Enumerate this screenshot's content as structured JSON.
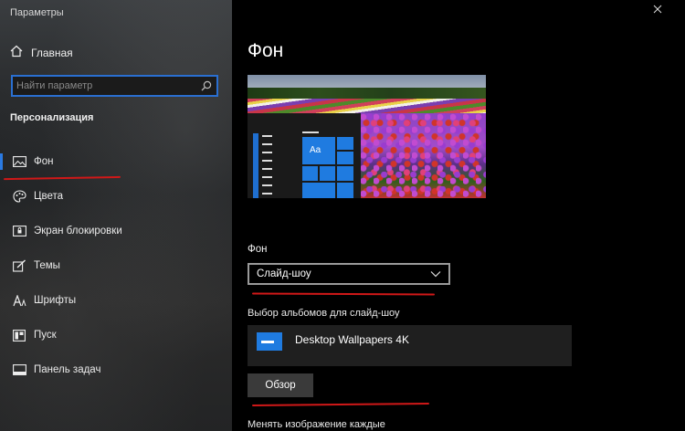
{
  "window": {
    "title": "Параметры",
    "close_icon": "close-icon"
  },
  "sidebar": {
    "home_label": "Главная",
    "search_placeholder": "Найти параметр",
    "section_title": "Персонализация",
    "items": [
      {
        "label": "Фон",
        "icon": "picture-icon",
        "active": true
      },
      {
        "label": "Цвета",
        "icon": "palette-icon",
        "active": false
      },
      {
        "label": "Экран блокировки",
        "icon": "lock-screen-icon",
        "active": false
      },
      {
        "label": "Темы",
        "icon": "brush-icon",
        "active": false
      },
      {
        "label": "Шрифты",
        "icon": "font-icon",
        "active": false
      },
      {
        "label": "Пуск",
        "icon": "start-icon",
        "active": false
      },
      {
        "label": "Панель задач",
        "icon": "taskbar-icon",
        "active": false
      }
    ]
  },
  "main": {
    "page_title": "Фон",
    "preview_tile_text": "Aa",
    "background_label": "Фон",
    "background_value": "Слайд-шоу",
    "albums_label": "Выбор альбомов для слайд-шоу",
    "album_name": "Desktop Wallpapers 4K",
    "browse_label": "Обзор",
    "change_every_label": "Менять изображение каждые"
  },
  "colors": {
    "accent": "#2a7ae2",
    "annotation_red": "#d01818",
    "tile_blue": "#1f7be0"
  }
}
